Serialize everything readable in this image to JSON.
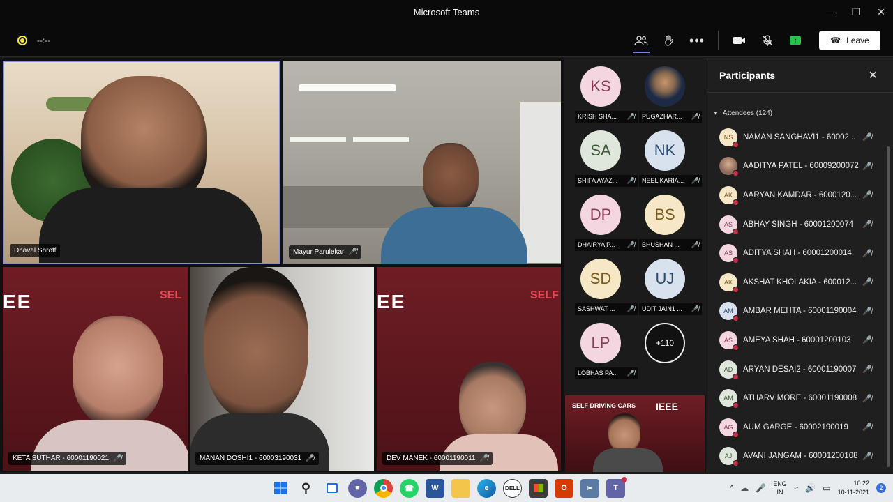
{
  "window": {
    "title": "Microsoft Teams"
  },
  "toolbar": {
    "timer": "--:--",
    "leave_label": "Leave"
  },
  "videos": [
    {
      "name": "Dhaval Shroff",
      "muted": false
    },
    {
      "name": "Mayur Parulekar",
      "muted": true
    },
    {
      "name": "KETA SUTHAR - 60001190021",
      "muted": true
    },
    {
      "name": "MANAN DOSHI1 - 60003190031",
      "muted": true
    },
    {
      "name": "DEV MANEK - 60001190011",
      "muted": true
    }
  ],
  "gallery": [
    {
      "initials": "KS",
      "name": "KRISH SHA...",
      "color": "#f3d6df"
    },
    {
      "initials": "",
      "name": "PUGAZHAR...",
      "color": "#2a3550"
    },
    {
      "initials": "SA",
      "name": "SHIFA AYAZ...",
      "color": "#dfe7dc"
    },
    {
      "initials": "NK",
      "name": "NEEL KARIA...",
      "color": "#d8e2ef"
    },
    {
      "initials": "DP",
      "name": "DHAIRYA P...",
      "color": "#f3d6df"
    },
    {
      "initials": "BS",
      "name": "BHUSHAN ...",
      "color": "#f6e8c6"
    },
    {
      "initials": "SD",
      "name": "SASHWAT ...",
      "color": "#f6e8c6"
    },
    {
      "initials": "UJ",
      "name": "UDIT JAIN1 ...",
      "color": "#d8e2ef"
    },
    {
      "initials": "LP",
      "name": "LOBHAS PA...",
      "color": "#f3d6df"
    }
  ],
  "gallery_more": "+110",
  "panel": {
    "title": "Participants",
    "attendees_label": "Attendees (124)",
    "people": [
      {
        "initials": "NS",
        "name": "NAMAN SANGHAVI1 - 60002...",
        "color": "#f6e8c6"
      },
      {
        "initials": "",
        "name": "AADITYA PATEL - 60009200072",
        "color": "#8a6a5a"
      },
      {
        "initials": "AK",
        "name": "AARYAN KAMDAR - 6000120...",
        "color": "#f6e8c6"
      },
      {
        "initials": "AS",
        "name": "ABHAY SINGH - 60001200074",
        "color": "#f3d6df"
      },
      {
        "initials": "AS",
        "name": "ADITYA SHAH - 60001200014",
        "color": "#f3d6df"
      },
      {
        "initials": "AK",
        "name": "AKSHAT KHOLAKIA - 600012...",
        "color": "#f6e8c6"
      },
      {
        "initials": "AM",
        "name": "AMBAR MEHTA - 60001190004",
        "color": "#d8e2ef"
      },
      {
        "initials": "AS",
        "name": "AMEYA SHAH - 60001200103",
        "color": "#f3d6df"
      },
      {
        "initials": "AD",
        "name": "ARYAN DESAI2 - 60001190007",
        "color": "#dfe7dc"
      },
      {
        "initials": "AM",
        "name": "ATHARV MORE - 60001190008",
        "color": "#dfe7dc"
      },
      {
        "initials": "AG",
        "name": "AUM GARGE - 60002190019",
        "color": "#f3d6df"
      },
      {
        "initials": "AJ",
        "name": "AVANI JANGAM - 60001200108",
        "color": "#dfe7dc"
      }
    ]
  },
  "taskbar": {
    "lang_top": "ENG",
    "lang_bottom": "IN",
    "time": "10:22",
    "date": "10-11-2021",
    "notifications": "2"
  },
  "colors": {
    "accent": "#7b83eb",
    "status_busy": "#c4314b",
    "share_green": "#26c24a"
  }
}
